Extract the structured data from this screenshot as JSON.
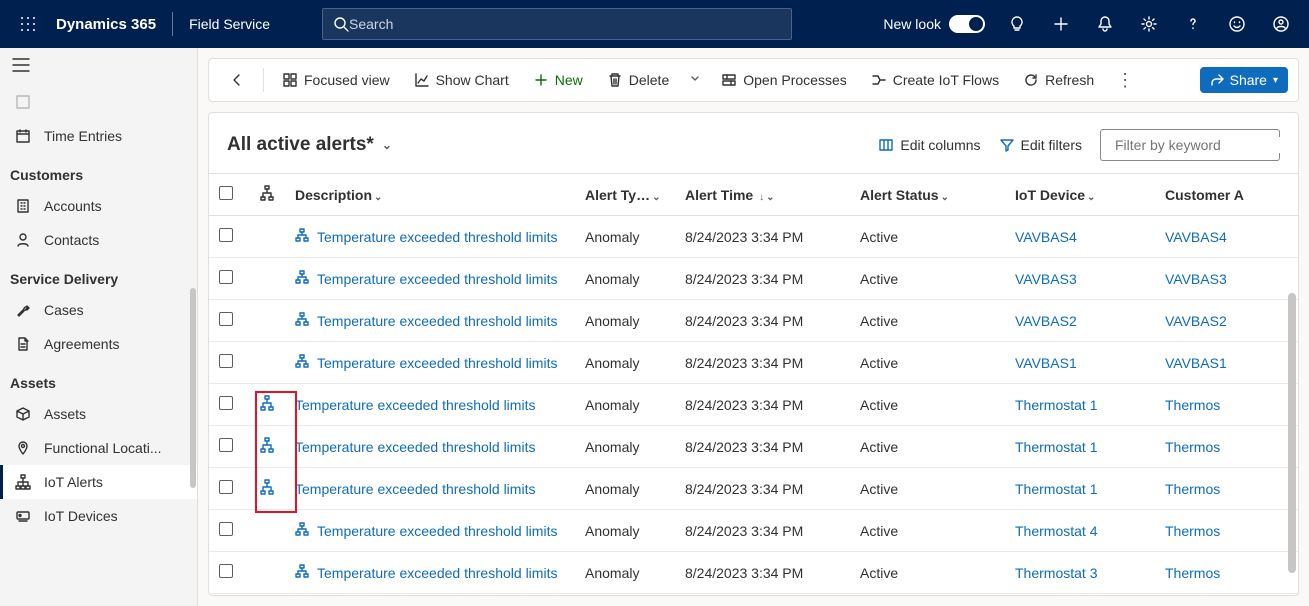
{
  "topbar": {
    "brand": "Dynamics 365",
    "app": "Field Service",
    "search_placeholder": "Search",
    "new_look": "New look"
  },
  "sidebar": {
    "items_top": [
      {
        "label": "",
        "hidden": true
      },
      {
        "label": "Time Entries",
        "icon": "calendar"
      }
    ],
    "sections": [
      {
        "title": "Customers",
        "items": [
          {
            "label": "Accounts",
            "icon": "building"
          },
          {
            "label": "Contacts",
            "icon": "person"
          }
        ]
      },
      {
        "title": "Service Delivery",
        "items": [
          {
            "label": "Cases",
            "icon": "wrench"
          },
          {
            "label": "Agreements",
            "icon": "document"
          }
        ]
      },
      {
        "title": "Assets",
        "items": [
          {
            "label": "Assets",
            "icon": "box"
          },
          {
            "label": "Functional Locati...",
            "icon": "pin"
          },
          {
            "label": "IoT Alerts",
            "icon": "hierarchy",
            "active": true
          },
          {
            "label": "IoT Devices",
            "icon": "device"
          }
        ]
      }
    ]
  },
  "commands": {
    "back": "Back",
    "focused": "Focused view",
    "show_chart": "Show Chart",
    "new": "New",
    "delete": "Delete",
    "open_processes": "Open Processes",
    "create_flows": "Create IoT Flows",
    "refresh": "Refresh",
    "share": "Share"
  },
  "view": {
    "title": "All active alerts*",
    "edit_columns": "Edit columns",
    "edit_filters": "Edit filters",
    "filter_placeholder": "Filter by keyword"
  },
  "columns": {
    "description": "Description",
    "alert_type": "Alert Ty…",
    "alert_time": "Alert Time",
    "alert_status": "Alert Status",
    "iot_device": "IoT Device",
    "customer": "Customer A"
  },
  "rows": [
    {
      "desc": "Temperature exceeded threshold limits",
      "type": "Anomaly",
      "time": "8/24/2023 3:34 PM",
      "status": "Active",
      "device": "VAVBAS4",
      "customer": "VAVBAS4",
      "hi": false
    },
    {
      "desc": "Temperature exceeded threshold limits",
      "type": "Anomaly",
      "time": "8/24/2023 3:34 PM",
      "status": "Active",
      "device": "VAVBAS3",
      "customer": "VAVBAS3",
      "hi": false
    },
    {
      "desc": "Temperature exceeded threshold limits",
      "type": "Anomaly",
      "time": "8/24/2023 3:34 PM",
      "status": "Active",
      "device": "VAVBAS2",
      "customer": "VAVBAS2",
      "hi": false
    },
    {
      "desc": "Temperature exceeded threshold limits",
      "type": "Anomaly",
      "time": "8/24/2023 3:34 PM",
      "status": "Active",
      "device": "VAVBAS1",
      "customer": "VAVBAS1",
      "hi": false
    },
    {
      "desc": "Temperature exceeded threshold limits",
      "type": "Anomaly",
      "time": "8/24/2023 3:34 PM",
      "status": "Active",
      "device": "Thermostat 1",
      "customer": "Thermos",
      "hi": true,
      "noSmallIcon": true
    },
    {
      "desc": "Temperature exceeded threshold limits",
      "type": "Anomaly",
      "time": "8/24/2023 3:34 PM",
      "status": "Active",
      "device": "Thermostat 1",
      "customer": "Thermos",
      "hi": true,
      "noSmallIcon": true
    },
    {
      "desc": "Temperature exceeded threshold limits",
      "type": "Anomaly",
      "time": "8/24/2023 3:34 PM",
      "status": "Active",
      "device": "Thermostat 1",
      "customer": "Thermos",
      "hi": true,
      "noSmallIcon": true
    },
    {
      "desc": "Temperature exceeded threshold limits",
      "type": "Anomaly",
      "time": "8/24/2023 3:34 PM",
      "status": "Active",
      "device": "Thermostat 4",
      "customer": "Thermos",
      "hi": false
    },
    {
      "desc": "Temperature exceeded threshold limits",
      "type": "Anomaly",
      "time": "8/24/2023 3:34 PM",
      "status": "Active",
      "device": "Thermostat 3",
      "customer": "Thermos",
      "hi": false
    }
  ]
}
